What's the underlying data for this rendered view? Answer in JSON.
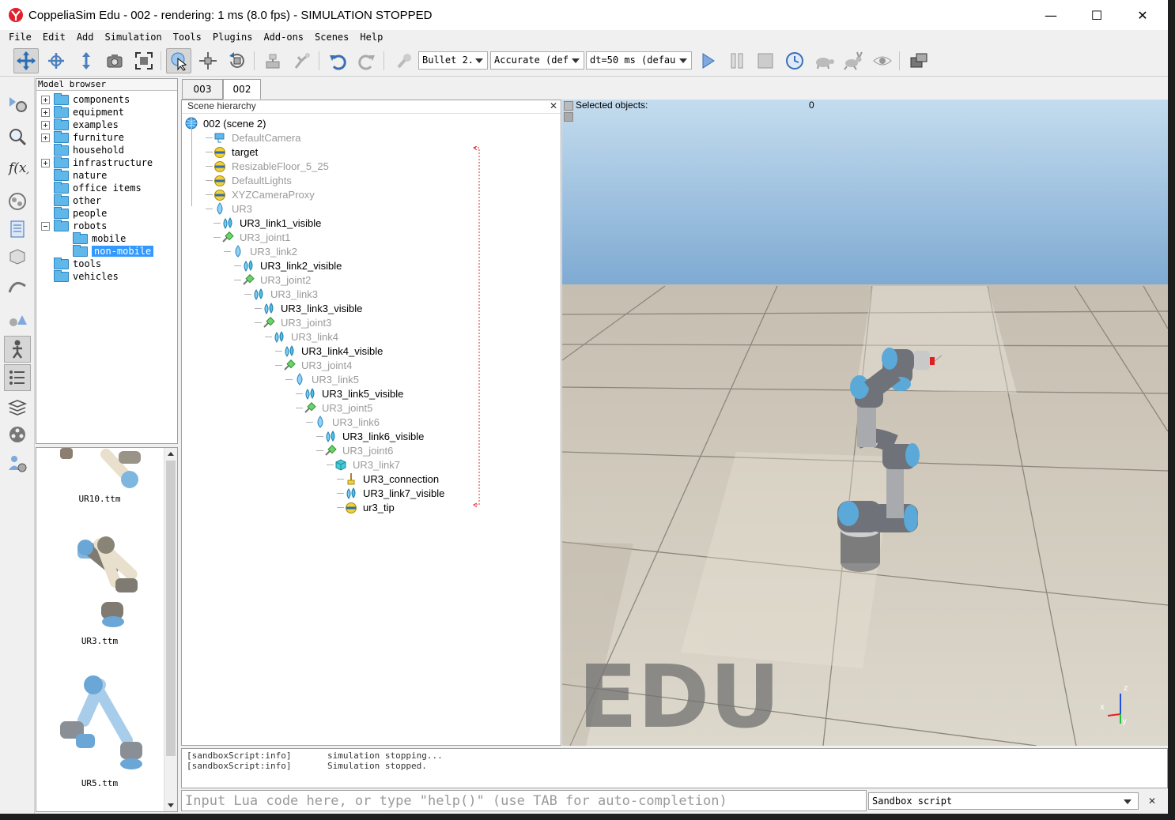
{
  "window": {
    "title": "CoppeliaSim Edu - 002 - rendering: 1 ms (8.0 fps) - SIMULATION STOPPED",
    "minimize": "—",
    "maximize": "☐",
    "close": "✕"
  },
  "menu": [
    "File",
    "Edit",
    "Add",
    "Simulation",
    "Tools",
    "Plugins",
    "Add-ons",
    "Scenes",
    "Help"
  ],
  "toolbar": {
    "engine": "Bullet 2.",
    "accuracy": "Accurate (def",
    "timestep": "dt=50 ms (defau"
  },
  "model_browser": {
    "title": "Model browser",
    "items": [
      {
        "label": "components",
        "expand": "plus"
      },
      {
        "label": "equipment",
        "expand": "plus"
      },
      {
        "label": "examples",
        "expand": "plus"
      },
      {
        "label": "furniture",
        "expand": "plus"
      },
      {
        "label": "household",
        "expand": "none"
      },
      {
        "label": "infrastructure",
        "expand": "plus"
      },
      {
        "label": "nature",
        "expand": "none"
      },
      {
        "label": "office items",
        "expand": "none"
      },
      {
        "label": "other",
        "expand": "none"
      },
      {
        "label": "people",
        "expand": "none"
      },
      {
        "label": "robots",
        "expand": "minus"
      },
      {
        "label": "mobile",
        "expand": "child"
      },
      {
        "label": "non-mobile",
        "expand": "child-selected"
      },
      {
        "label": "tools",
        "expand": "none"
      },
      {
        "label": "vehicles",
        "expand": "none"
      }
    ]
  },
  "thumbnails": [
    {
      "label": "UR10.ttm"
    },
    {
      "label": "UR3.ttm"
    },
    {
      "label": "UR5.ttm"
    }
  ],
  "scene_tabs": [
    {
      "label": "003"
    },
    {
      "label": "002"
    }
  ],
  "hierarchy": {
    "title": "Scene hierarchy",
    "close": "✕",
    "rows": [
      {
        "label": "002 (scene 2)",
        "icon": "globe-icon",
        "dim": false,
        "depth": 0
      },
      {
        "label": "DefaultCamera",
        "icon": "camera-icon",
        "dim": true,
        "depth": 1
      },
      {
        "label": "target",
        "icon": "dummy-icon",
        "dim": false,
        "depth": 1
      },
      {
        "label": "ResizableFloor_5_25",
        "icon": "dummy-icon",
        "dim": true,
        "depth": 1
      },
      {
        "label": "DefaultLights",
        "icon": "dummy-icon",
        "dim": true,
        "depth": 1
      },
      {
        "label": "XYZCameraProxy",
        "icon": "dummy-icon",
        "dim": true,
        "depth": 1
      },
      {
        "label": "UR3",
        "icon": "shape-icon",
        "dim": true,
        "depth": 1
      },
      {
        "label": "UR3_link1_visible",
        "icon": "multishape-icon",
        "dim": false,
        "depth": 2
      },
      {
        "label": "UR3_joint1",
        "icon": "joint-icon",
        "dim": true,
        "depth": 2
      },
      {
        "label": "UR3_link2",
        "icon": "shape-icon",
        "dim": true,
        "depth": 3
      },
      {
        "label": "UR3_link2_visible",
        "icon": "multishape-icon",
        "dim": false,
        "depth": 4
      },
      {
        "label": "UR3_joint2",
        "icon": "joint-icon",
        "dim": true,
        "depth": 4
      },
      {
        "label": "UR3_link3",
        "icon": "multishape-icon",
        "dim": true,
        "depth": 5
      },
      {
        "label": "UR3_link3_visible",
        "icon": "multishape-icon",
        "dim": false,
        "depth": 6
      },
      {
        "label": "UR3_joint3",
        "icon": "joint-icon",
        "dim": true,
        "depth": 6
      },
      {
        "label": "UR3_link4",
        "icon": "multishape-icon",
        "dim": true,
        "depth": 7
      },
      {
        "label": "UR3_link4_visible",
        "icon": "multishape-icon",
        "dim": false,
        "depth": 8
      },
      {
        "label": "UR3_joint4",
        "icon": "joint-icon",
        "dim": true,
        "depth": 8
      },
      {
        "label": "UR3_link5",
        "icon": "shape-icon",
        "dim": true,
        "depth": 9
      },
      {
        "label": "UR3_link5_visible",
        "icon": "multishape-icon",
        "dim": false,
        "depth": 10
      },
      {
        "label": "UR3_joint5",
        "icon": "joint-icon",
        "dim": true,
        "depth": 10
      },
      {
        "label": "UR3_link6",
        "icon": "shape-icon",
        "dim": true,
        "depth": 11
      },
      {
        "label": "UR3_link6_visible",
        "icon": "multishape-icon",
        "dim": false,
        "depth": 12
      },
      {
        "label": "UR3_joint6",
        "icon": "joint-icon",
        "dim": true,
        "depth": 12
      },
      {
        "label": "UR3_link7",
        "icon": "cube-icon",
        "dim": true,
        "depth": 13
      },
      {
        "label": "UR3_connection",
        "icon": "connection-icon",
        "dim": false,
        "depth": 14
      },
      {
        "label": "UR3_link7_visible",
        "icon": "multishape-icon",
        "dim": false,
        "depth": 14
      },
      {
        "label": "ur3_tip",
        "icon": "dummy-icon",
        "dim": false,
        "depth": 14
      }
    ]
  },
  "viewport": {
    "selected_label": "Selected objects:",
    "selected_count": "0",
    "watermark": "EDU",
    "axis_x": "x",
    "axis_y": "y",
    "axis_z": "z"
  },
  "console": {
    "lines": [
      {
        "src": "[sandboxScript:info]",
        "msg": "simulation  stopping..."
      },
      {
        "src": "[sandboxScript:info]",
        "msg": "Simulation  stopped."
      }
    ]
  },
  "lua_input": {
    "placeholder": "Input Lua code here, or type \"help()\" (use TAB for auto-completion)"
  },
  "script_select": {
    "value": "Sandbox script"
  },
  "clear_button": "✕",
  "colors": {
    "selection": "#3399ff",
    "folder": "#5fb7ea",
    "sky": "#8fbfe6",
    "floor": "#d9d3c6",
    "robot_blue": "#5aa9d8"
  }
}
